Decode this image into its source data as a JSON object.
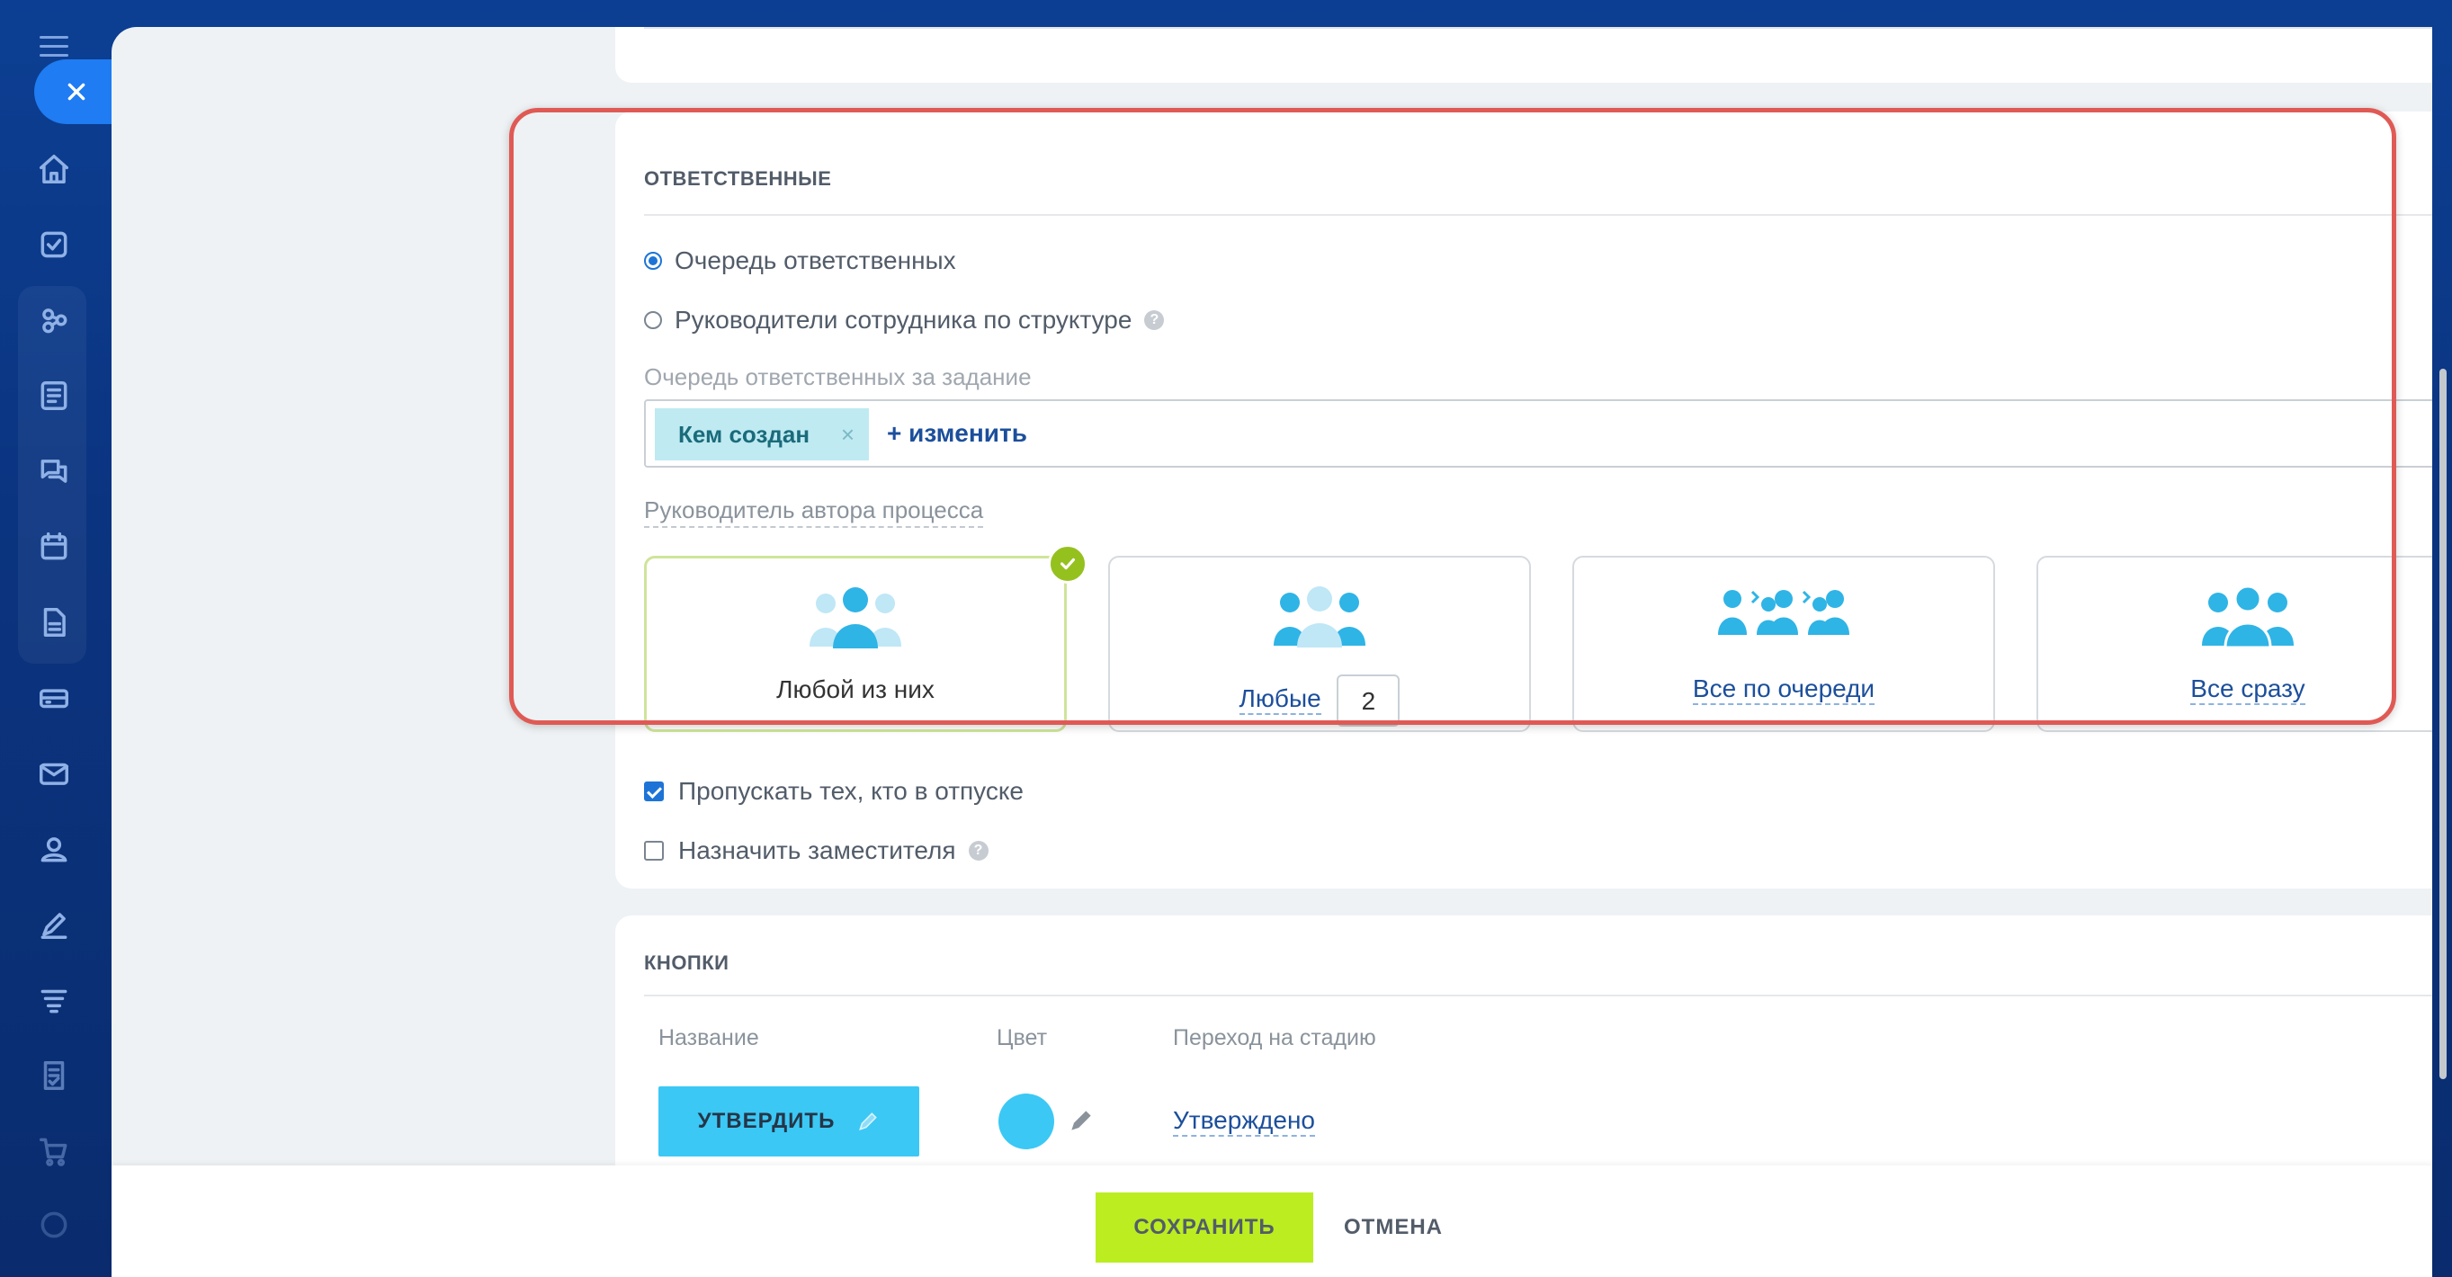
{
  "responsible": {
    "title": "ОТВЕТСТВЕННЫЕ",
    "radio_queue": "Очередь ответственных",
    "radio_structure": "Руководители сотрудника по структуре",
    "queue_label": "Очередь ответственных за задание",
    "tag_label": "Кем создан",
    "tag_remove": "×",
    "change_link": "+ изменить",
    "author_head_label": "Руководитель автора процесса",
    "options": [
      {
        "label": "Любой из них",
        "selected": true
      },
      {
        "label": "Любые",
        "count": "2"
      },
      {
        "label": "Все по очереди"
      },
      {
        "label": "Все сразу"
      }
    ],
    "skip_vacation": "Пропускать тех, кто в отпуске",
    "assign_deputy": "Назначить заместителя",
    "help_mark": "?"
  },
  "buttons_section": {
    "title": "КНОПКИ",
    "col_name": "Название",
    "col_color": "Цвет",
    "col_stage": "Переход на стадию",
    "row": {
      "button_label": "УТВЕРДИТЬ",
      "color": "#3bc8f5",
      "stage": "Утверждено"
    }
  },
  "footer": {
    "save_label": "СОХРАНИТЬ",
    "cancel_label": "ОТМЕНА"
  },
  "colors": {
    "accent_blue": "#1e74d6",
    "save_green": "#bbed21",
    "highlight_red": "#e05a55",
    "people_blue": "#2fb4e6"
  },
  "sidebar_icons": [
    "menu-icon",
    "home-icon",
    "tasks-icon",
    "crm-icon",
    "feed-icon",
    "chat-icon",
    "calendar-icon",
    "document-icon",
    "drive-icon",
    "mail-icon",
    "contacts-icon",
    "sign-icon",
    "automation-icon",
    "forms-icon",
    "shop-icon"
  ]
}
